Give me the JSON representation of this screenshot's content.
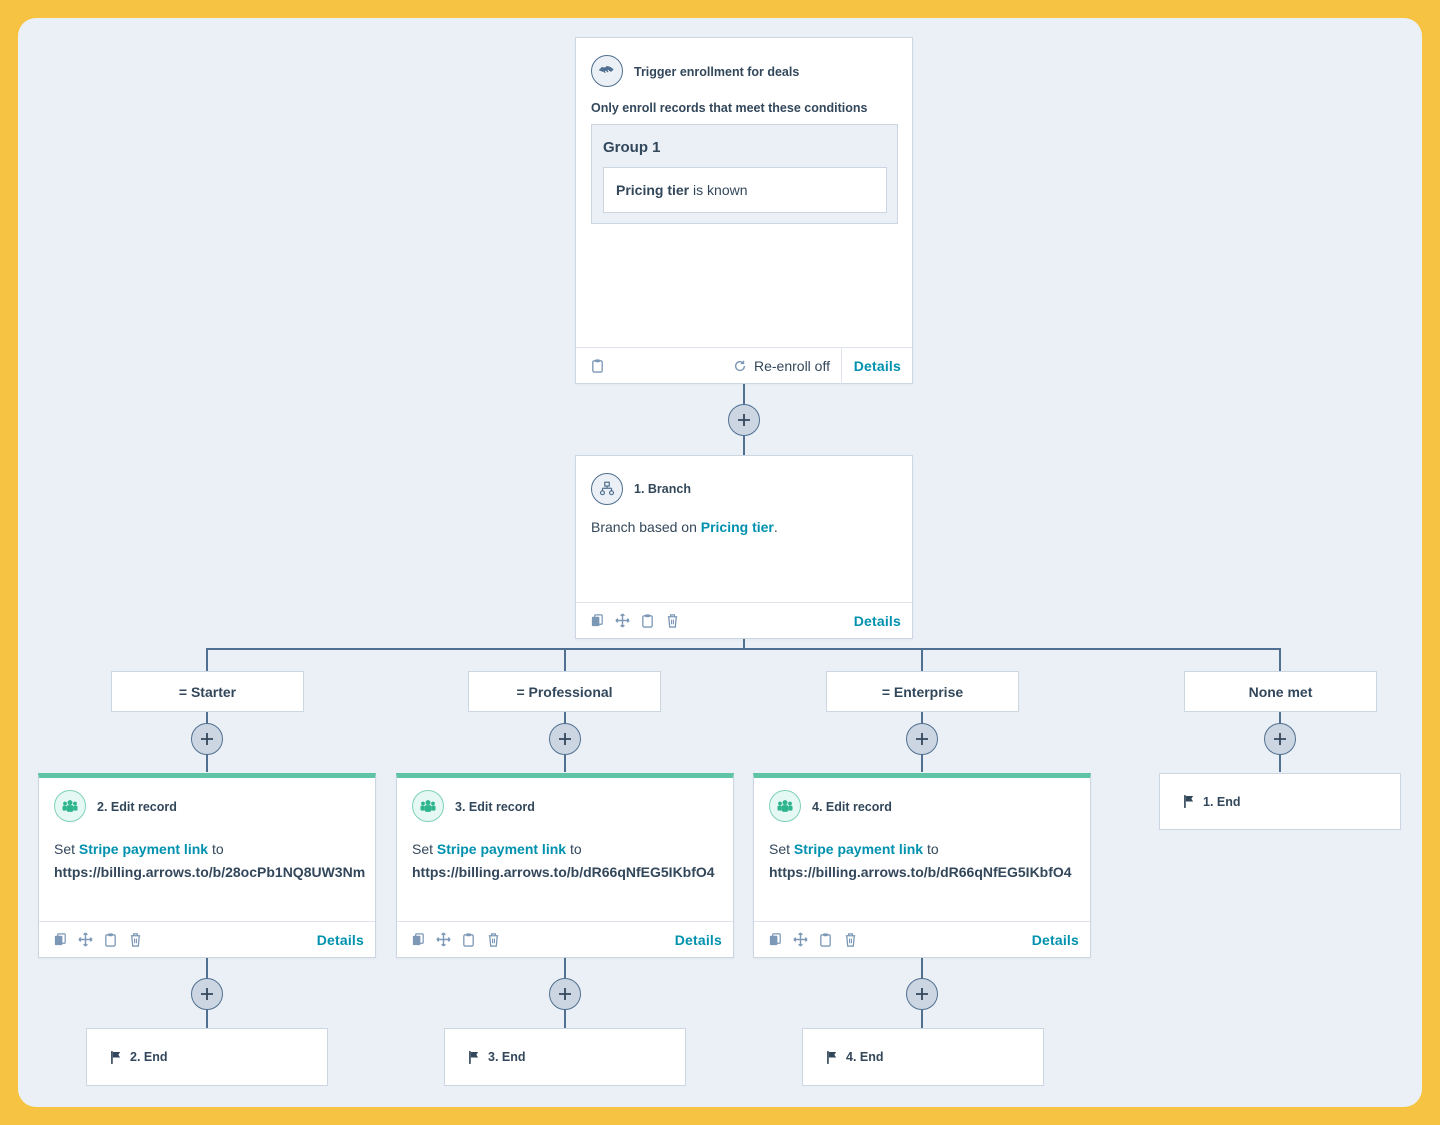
{
  "trigger": {
    "title": "Trigger enrollment for deals",
    "subtitle": "Only enroll records that meet these conditions",
    "group_label": "Group 1",
    "condition_property": "Pricing tier",
    "condition_operator": "is known",
    "reenroll_label": "Re-enroll off",
    "details_label": "Details"
  },
  "branch": {
    "title": "1. Branch",
    "text_prefix": "Branch based on ",
    "text_link": "Pricing tier",
    "text_suffix": ".",
    "details_label": "Details"
  },
  "branches": [
    {
      "label": "= Starter",
      "action_title": "2. Edit record",
      "set_prefix": "Set ",
      "property": "Stripe payment link",
      "set_suffix": " to",
      "value": "https://billing.arrows.to/b/28ocPb1NQ8UW3Nm",
      "details_label": "Details",
      "end_label": "2. End"
    },
    {
      "label": "= Professional",
      "action_title": "3. Edit record",
      "set_prefix": "Set ",
      "property": "Stripe payment link",
      "set_suffix": " to",
      "value": "https://billing.arrows.to/b/dR66qNfEG5IKbfO4",
      "details_label": "Details",
      "end_label": "3. End"
    },
    {
      "label": "= Enterprise",
      "action_title": "4. Edit record",
      "set_prefix": "Set ",
      "property": "Stripe payment link",
      "set_suffix": " to",
      "value": "https://billing.arrows.to/b/dR66qNfEG5IKbfO4",
      "details_label": "Details",
      "end_label": "4. End"
    },
    {
      "label": "None met",
      "end_label": "1. End"
    }
  ],
  "icons": {
    "trigger": "handshake-icon",
    "branch": "branch-icon",
    "edit": "people-icon",
    "end": "flag-icon",
    "add": "plus-icon",
    "clone": "copy-icon",
    "move": "move-icon",
    "clipboard": "clipboard-icon",
    "delete": "trash-icon",
    "reenroll": "refresh-icon"
  },
  "colors": {
    "accent": "#0091ae",
    "edit_bar": "#5ec4a5",
    "connector": "#516f90",
    "canvas": "#eaf0f6",
    "frame": "#f6c343"
  }
}
